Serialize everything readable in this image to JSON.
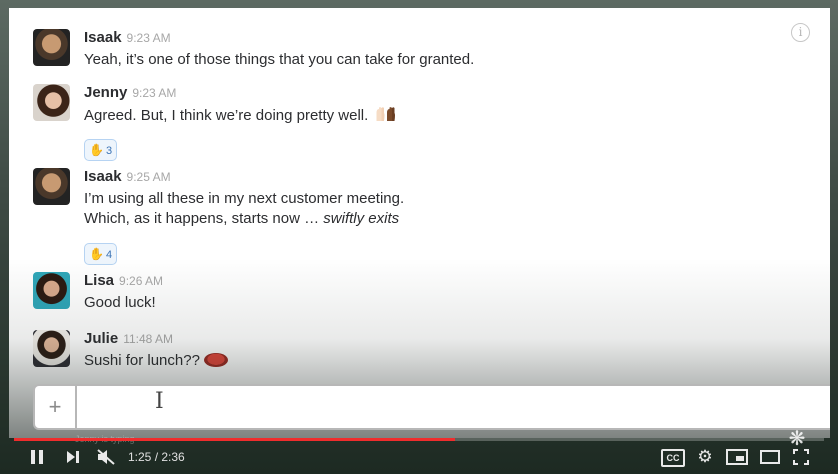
{
  "player": {
    "current_time": "1:25",
    "separator": " / ",
    "duration": "2:36",
    "progress": 0.545,
    "accent_color": "#ee2d2d",
    "cc_label": "CC",
    "buttons": [
      "pause-icon",
      "next-icon",
      "mute-icon",
      "cc-icon",
      "settings-icon",
      "miniplayer-icon",
      "theater-icon",
      "fullscreen-icon"
    ]
  },
  "chat": {
    "typing_indicator": "Jenny is typing",
    "composer_plus": "+",
    "messages": [
      {
        "author": "Isaak",
        "time": "9:23 AM",
        "lines": [
          "Yeah, it’s one of those things that you can take for granted."
        ]
      },
      {
        "author": "Jenny",
        "time": "9:23 AM",
        "lines": [
          "Agreed. But, I think we’re doing pretty well."
        ],
        "emoji": "raised-hands-emoji",
        "reaction": {
          "emoji": "raised-hands-emoji",
          "count": "3"
        }
      },
      {
        "author": "Isaak",
        "time": "9:25 AM",
        "lines": [
          "I’m using all these in my next customer meeting.",
          "Which, as it happens, starts now … "
        ],
        "italic_tail": "swiftly exits",
        "reaction": {
          "emoji": "wave-emoji",
          "count": "4"
        }
      },
      {
        "author": "Lisa",
        "time": "9:26 AM",
        "lines": [
          "Good luck!"
        ]
      },
      {
        "author": "Julie",
        "time": "11:48 AM",
        "lines": [
          "Sushi for lunch??"
        ],
        "emoji": "sushi-emoji"
      }
    ]
  }
}
